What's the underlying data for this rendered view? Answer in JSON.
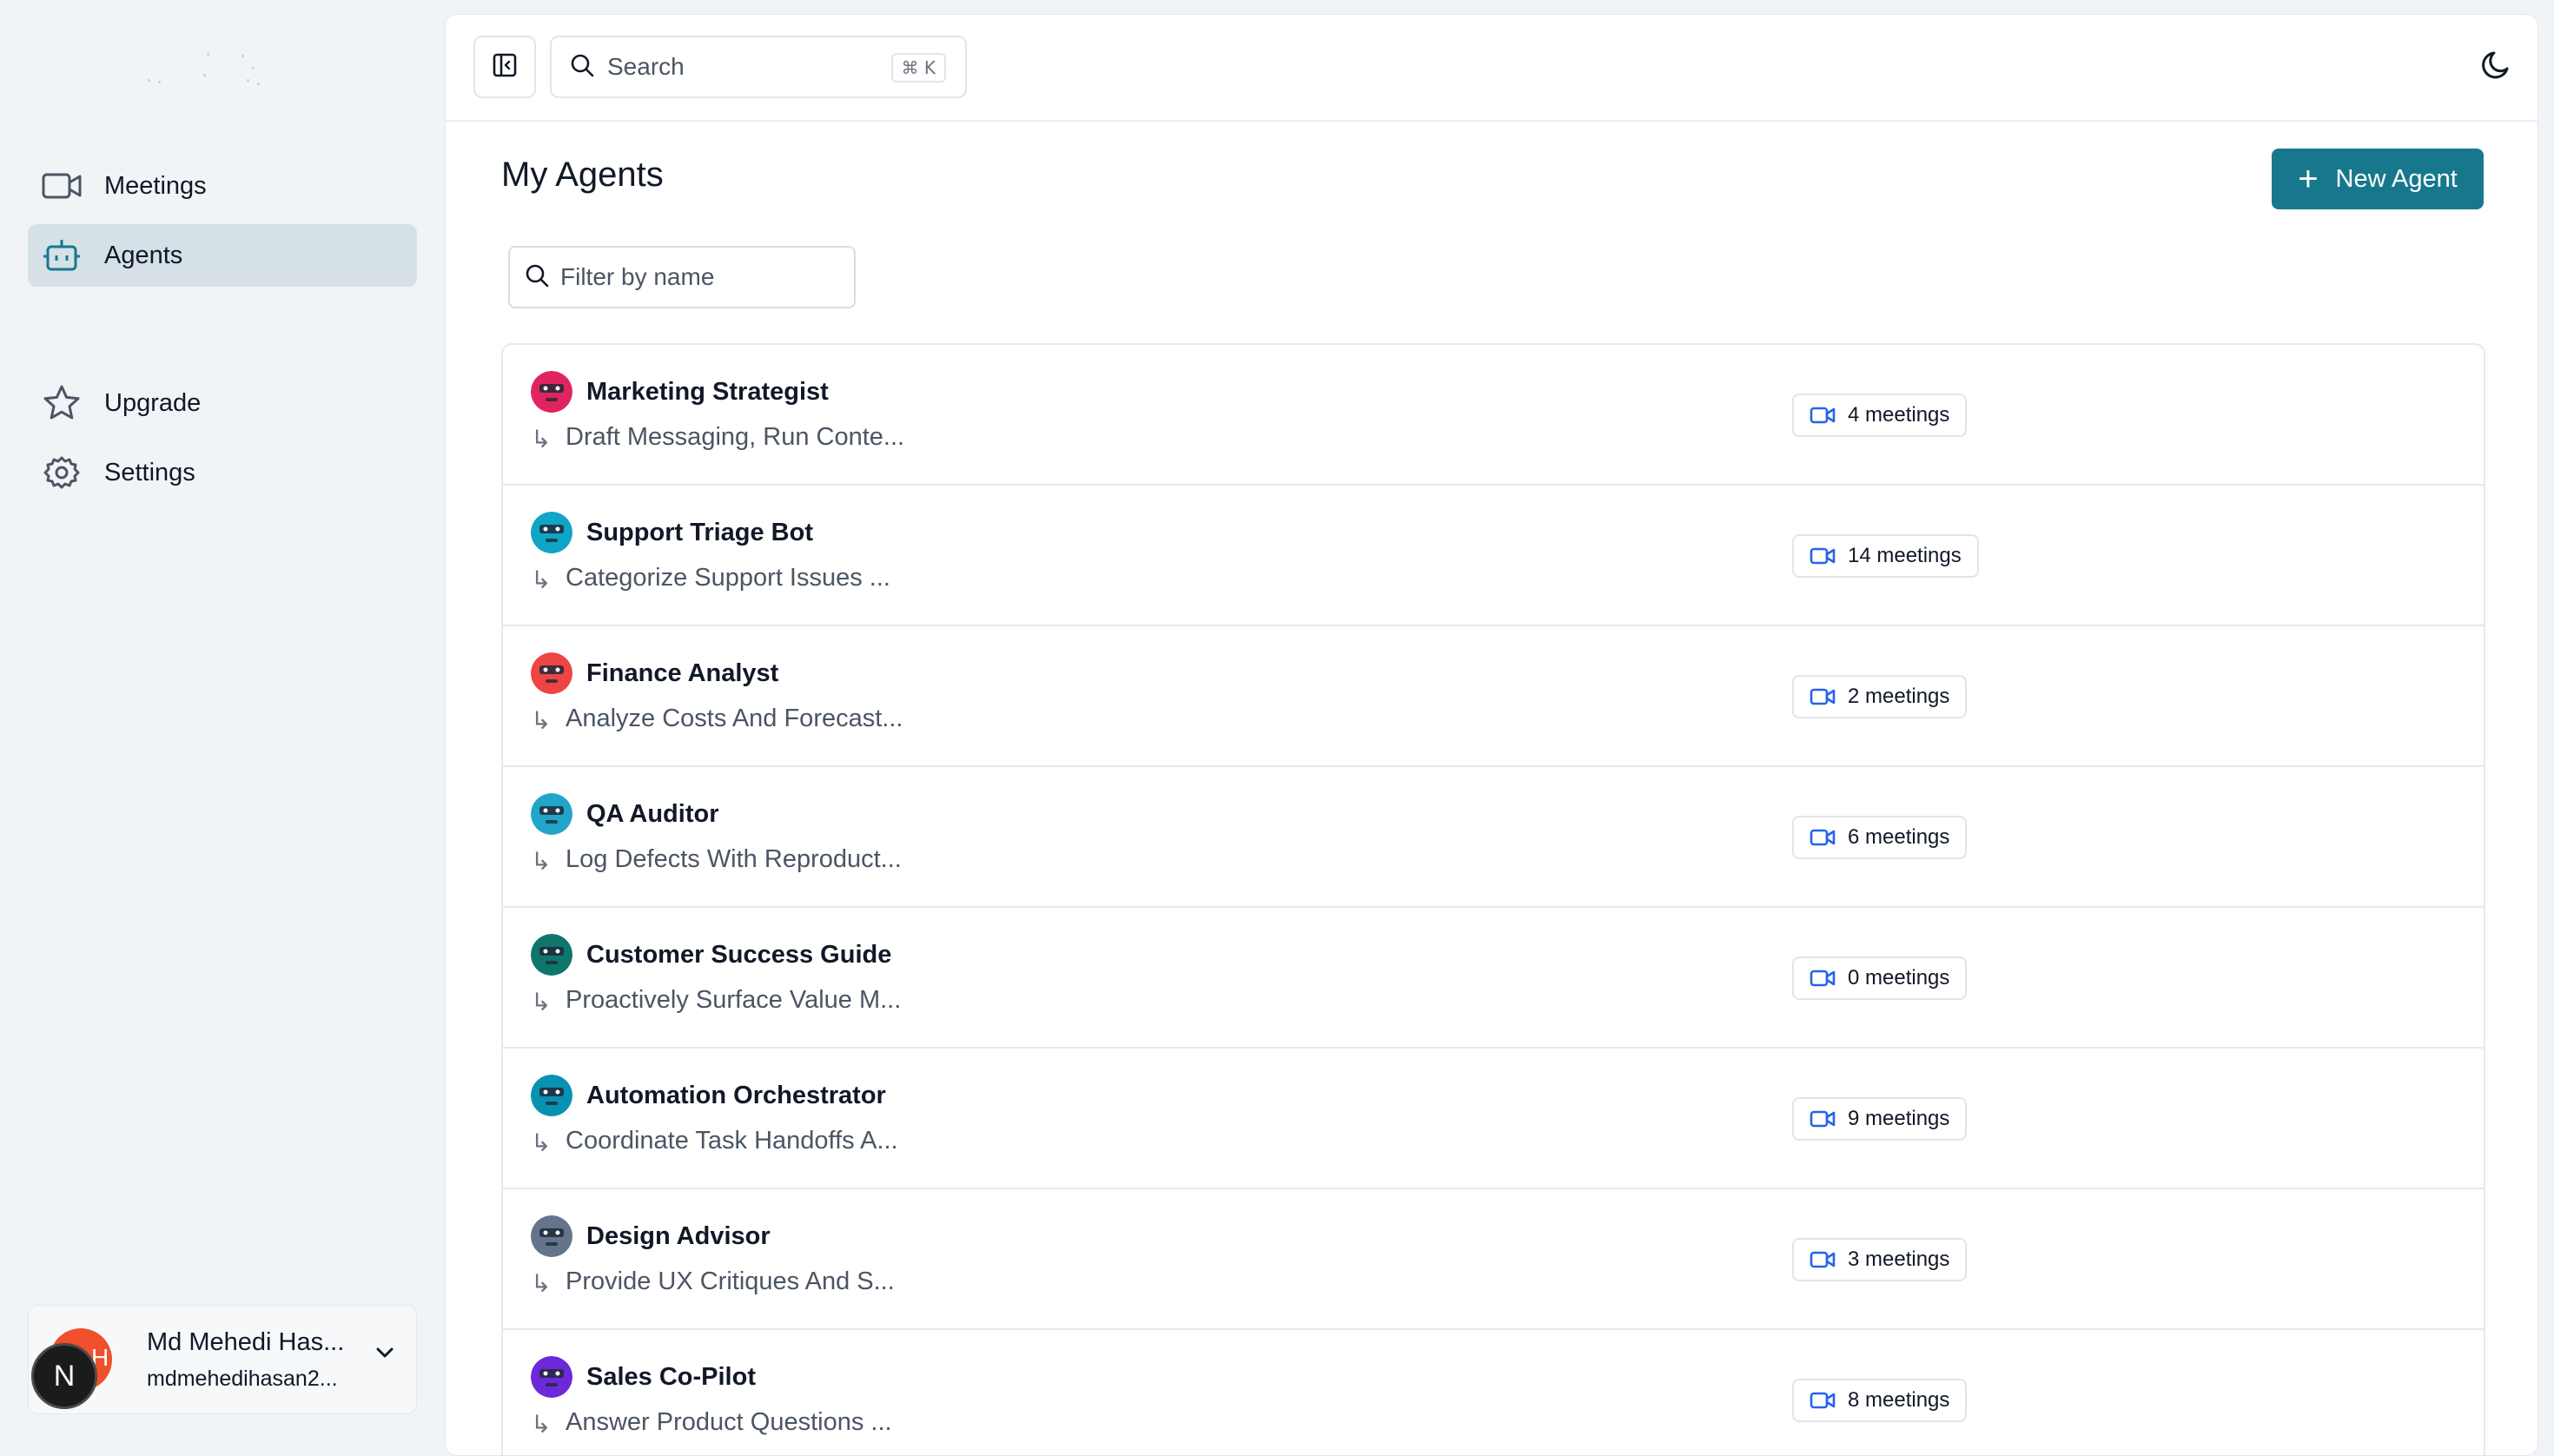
{
  "sidebar": {
    "nav": [
      {
        "label": "Meetings",
        "icon": "video-icon"
      },
      {
        "label": "Agents",
        "icon": "bot-icon",
        "active": true
      }
    ],
    "secondary": [
      {
        "label": "Upgrade",
        "icon": "star-icon"
      },
      {
        "label": "Settings",
        "icon": "gear-icon"
      }
    ],
    "user": {
      "name": "Md Mehedi Has...",
      "email": "mdmehedihasan2...",
      "avatar_letter": "H"
    },
    "next_badge": "N"
  },
  "topbar": {
    "search_placeholder": "Search",
    "shortcut": "⌘ K"
  },
  "page": {
    "title": "My Agents",
    "new_agent_label": "New Agent",
    "filter_placeholder": "Filter by name"
  },
  "agents": [
    {
      "name": "Marketing Strategist",
      "description": "Draft Messaging, Run Conte...",
      "meetings": "4 meetings",
      "avatar_color": "#e0245e"
    },
    {
      "name": "Support Triage Bot",
      "description": "Categorize Support Issues ...",
      "meetings": "14 meetings",
      "avatar_color": "#0ea5c6"
    },
    {
      "name": "Finance Analyst",
      "description": "Analyze Costs And Forecast...",
      "meetings": "2 meetings",
      "avatar_color": "#ef4444"
    },
    {
      "name": "QA Auditor",
      "description": "Log Defects With Reproduct...",
      "meetings": "6 meetings",
      "avatar_color": "#22a6c8"
    },
    {
      "name": "Customer Success Guide",
      "description": "Proactively Surface Value M...",
      "meetings": "0 meetings",
      "avatar_color": "#0f766e"
    },
    {
      "name": "Automation Orchestrator",
      "description": "Coordinate Task Handoffs A...",
      "meetings": "9 meetings",
      "avatar_color": "#0891b2"
    },
    {
      "name": "Design Advisor",
      "description": "Provide UX Critiques And S...",
      "meetings": "3 meetings",
      "avatar_color": "#64748b"
    },
    {
      "name": "Sales Co-Pilot",
      "description": "Answer Product Questions ...",
      "meetings": "8 meetings",
      "avatar_color": "#6d28d9"
    }
  ],
  "colors": {
    "accent": "#17788d",
    "active_nav_bg": "#d6e0e7",
    "badge_icon": "#2563eb"
  }
}
